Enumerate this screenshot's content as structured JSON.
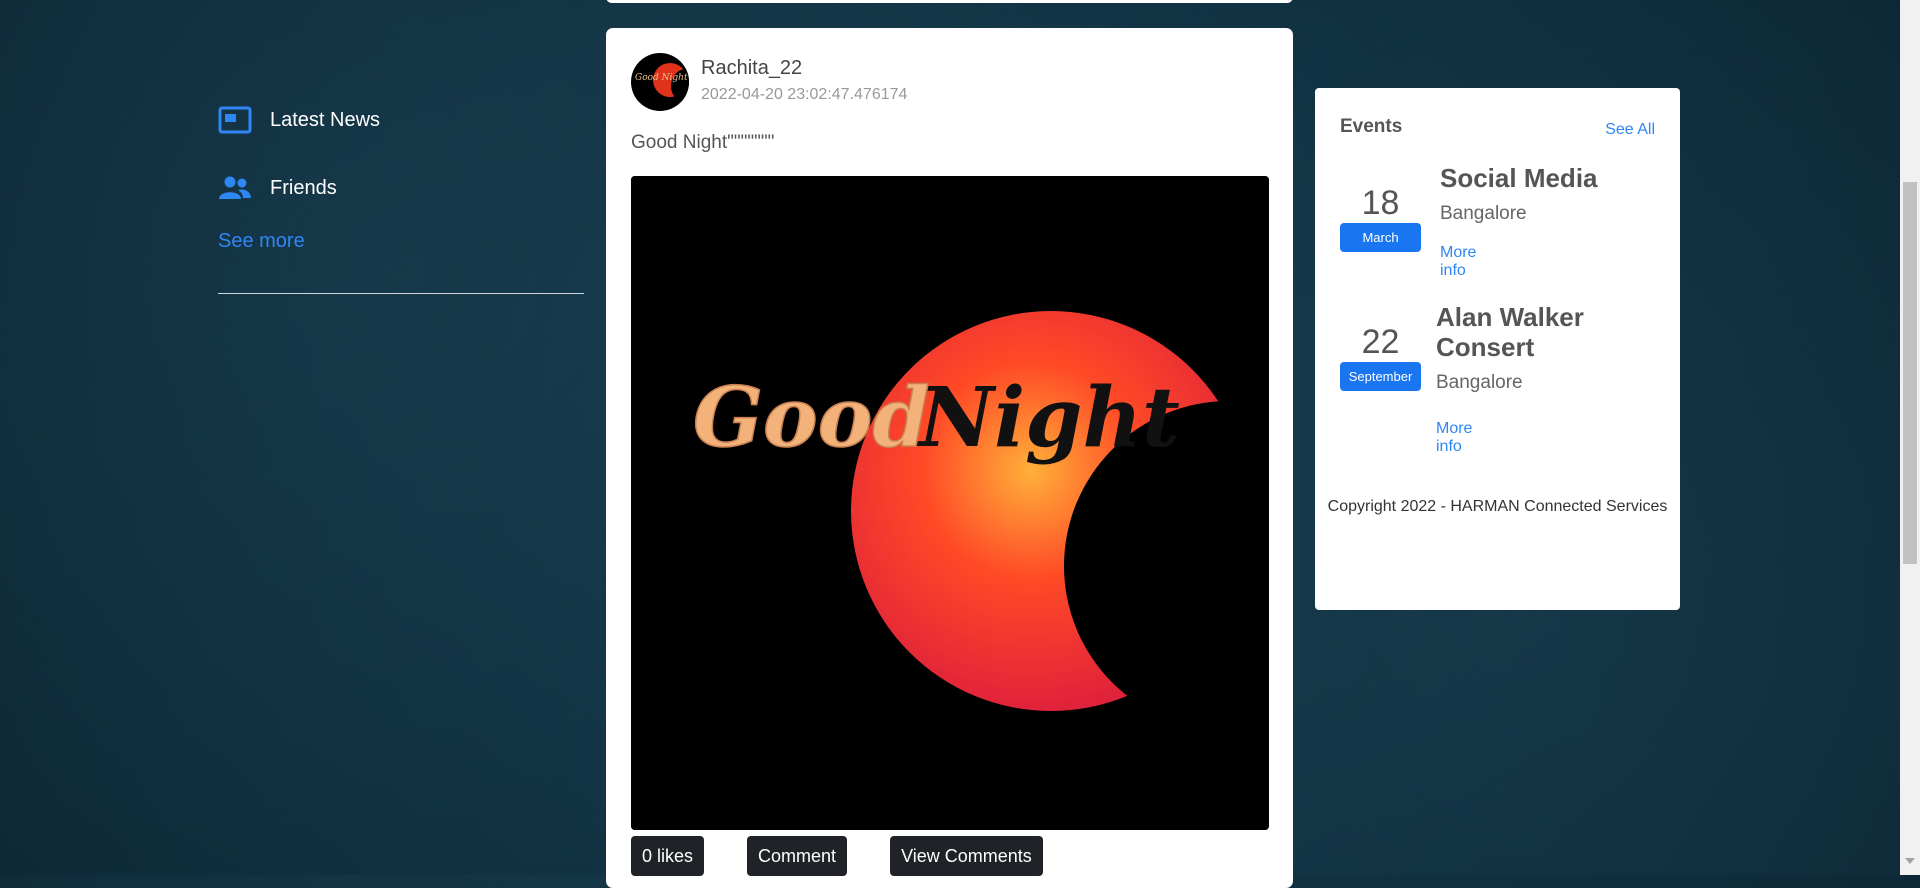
{
  "nav": {
    "items": [
      {
        "label": "Latest News",
        "icon": "news-icon"
      },
      {
        "label": "Friends",
        "icon": "friends-icon"
      }
    ],
    "see_more": "See more"
  },
  "post": {
    "username": "Rachita_22",
    "timestamp": "2022-04-20 23:02:47.476174",
    "text": "Good Night\"\"\"\"\"\"\"",
    "image_text": "Good Night",
    "actions": {
      "likes": "0 likes",
      "comment": "Comment",
      "view_comments": "View Comments"
    }
  },
  "events": {
    "title": "Events",
    "see_all": "See All",
    "items": [
      {
        "day": "18",
        "month": "March",
        "title": "Social Media",
        "place": "Bangalore",
        "more": "More info"
      },
      {
        "day": "22",
        "month": "September",
        "title": "Alan Walker Consert",
        "place": "Bangalore",
        "more": "More info"
      }
    ],
    "copyright": "Copyright 2022 - HARMAN Connected Services"
  },
  "colors": {
    "accent": "#1a75f0",
    "link": "#2f86f5",
    "background": "#0d2c3d",
    "button": "#1f2226"
  }
}
